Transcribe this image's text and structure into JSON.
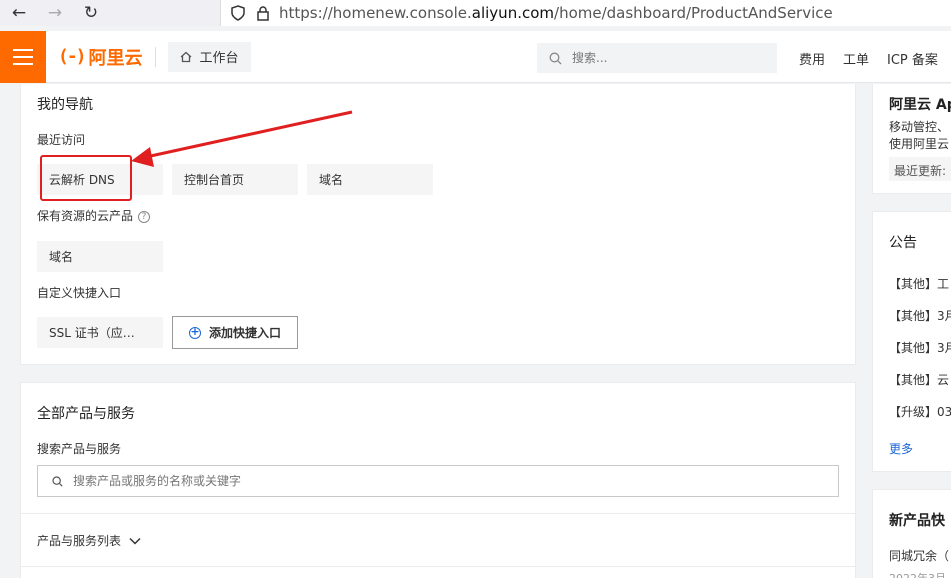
{
  "browser": {
    "url_prefix": "https://homenew.console.",
    "url_host": "aliyun.com",
    "url_path": "/home/dashboard/ProductAndService"
  },
  "header": {
    "logo_mark": "(-)",
    "logo_text": "阿里云",
    "workbench_label": "工作台",
    "search_placeholder": "搜索...",
    "links": [
      "费用",
      "工单",
      "ICP 备案"
    ]
  },
  "my_nav": {
    "title": "我的导航",
    "recent_label": "最近访问",
    "recent_items": [
      "云解析 DNS",
      "控制台首页",
      "域名"
    ],
    "owned_label": "保有资源的云产品",
    "owned_help": "?",
    "owned_items": [
      "域名"
    ],
    "custom_label": "自定义快捷入口",
    "custom_items": [
      "SSL 证书（应…"
    ],
    "add_shortcut_label": "添加快捷入口",
    "add_icon": "+"
  },
  "all_products": {
    "title": "全部产品与服务",
    "search_label": "搜索产品与服务",
    "search_placeholder": "搜索产品或服务的名称或关键字",
    "list_label": "产品与服务列表"
  },
  "right_app": {
    "title": "阿里云 Ap",
    "line1": "移动管控、",
    "line2": "使用阿里云",
    "updated": "最近更新:"
  },
  "announcements": {
    "title": "公告",
    "items": [
      "【其他】工",
      "【其他】3月",
      "【其他】3月",
      "【其他】云",
      "【升级】03"
    ],
    "more": "更多"
  },
  "new_products": {
    "title": "新产品快",
    "item": "同城冗余（",
    "date": "2022年3月"
  },
  "colors": {
    "brand": "#ff6a00",
    "highlight": "#e02020",
    "link": "#1a66d6"
  }
}
